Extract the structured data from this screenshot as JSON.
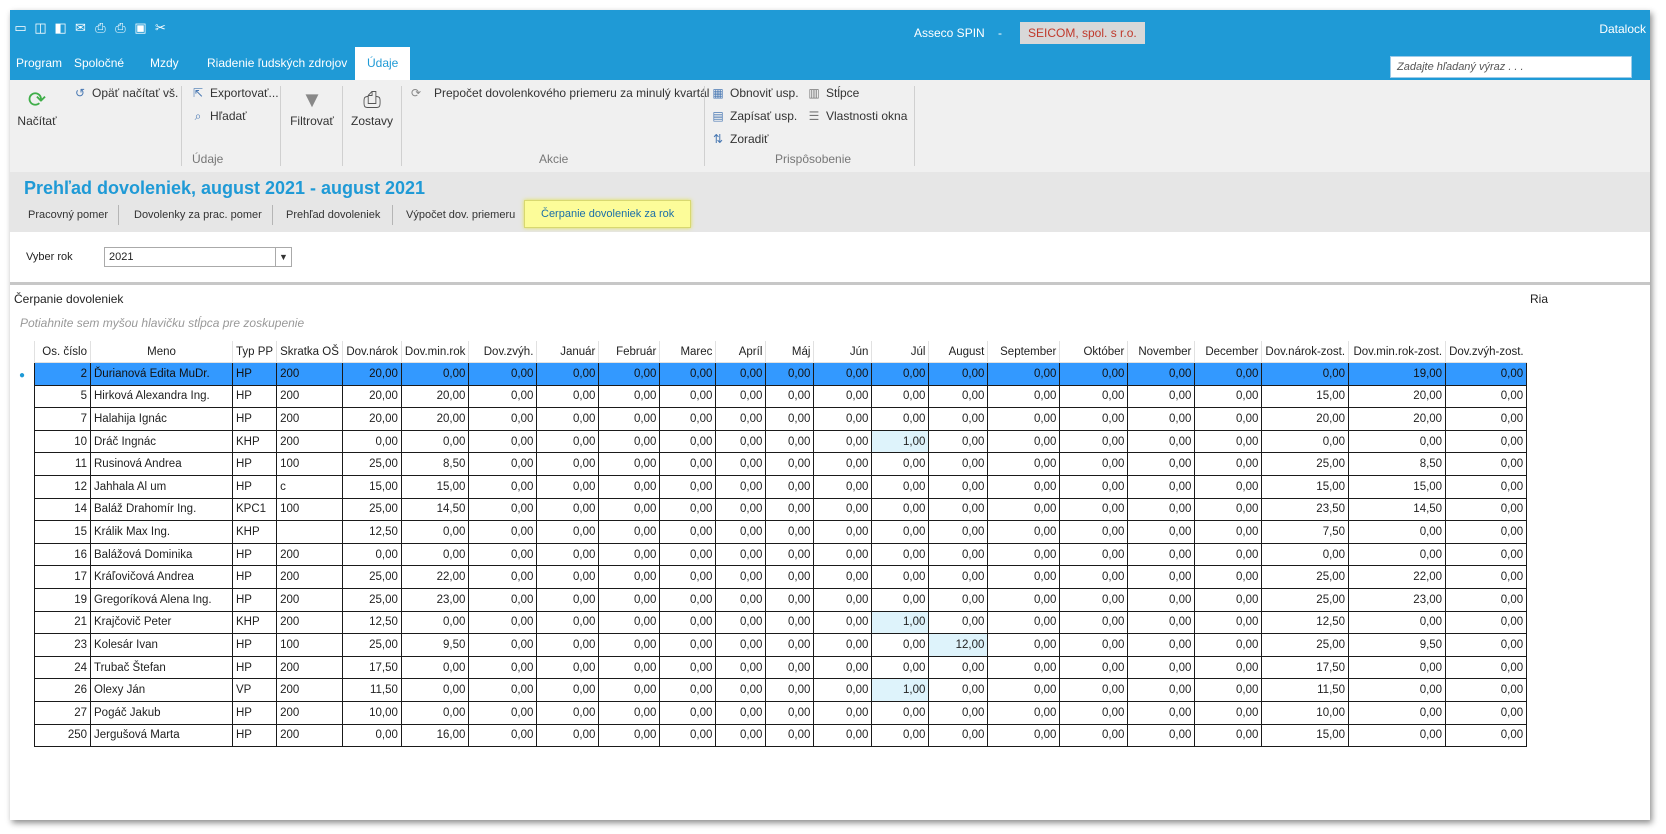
{
  "titlebar": {
    "qat_icons": [
      "minimize-icon",
      "dock-icon",
      "undock-icon",
      "mail-icon",
      "print-icon",
      "print-preview-icon",
      "export-icon",
      "tools-icon"
    ],
    "app_name": "Asseco SPIN",
    "separator": "-",
    "company": "SEICOM, spol. s r.o.",
    "right_label": "Datalock"
  },
  "menu": {
    "items": [
      "Program",
      "Spoločné",
      "Mzdy",
      "Riadenie ľudských zdrojov",
      "Údaje"
    ],
    "active": "Údaje",
    "search_placeholder": "Zadajte hľadaný výraz . . ."
  },
  "ribbon": {
    "nacitat": "Načítať",
    "opat": "Opäť načítať vš.",
    "exportovat": "Exportovať...",
    "hladat": "Hľadať",
    "filtrovat": "Filtrovať",
    "zostavy": "Zostavy",
    "prepocet": "Prepočet dovolenkového priemeru za minulý kvartál",
    "obnovit": "Obnoviť usp.",
    "zapisat": "Zapísať usp.",
    "zoradit": "Zoradiť",
    "stlpce": "Stĺpce",
    "vlastnosti": "Vlastnosti okna",
    "groups": {
      "udaje": "Údaje",
      "akcie": "Akcie",
      "prisposobenie": "Prispôsobenie"
    }
  },
  "page": {
    "title": "Prehľad dovoleniek, august 2021 - august 2021",
    "tabs": [
      "Pracovný pomer",
      "Dovolenky za prac. pomer",
      "Prehľad dovoleniek",
      "Výpočet dov. priemeru",
      "Čerpanie dovoleniek za rok"
    ],
    "active_tab": "Čerpanie dovoleniek za rok"
  },
  "filter": {
    "label": "Vyber rok",
    "value": "2021"
  },
  "grid": {
    "title": "Čerpanie dovoleniek",
    "right_label": "Ria",
    "group_hint": "Potiahnite sem myšou hlavičku stĺpca pre zoskupenie",
    "columns": [
      "Os. číslo",
      "Meno",
      "Typ PP",
      "Skratka OŠ",
      "Dov.nárok",
      "Dov.min.rok",
      "Dov.zvýh.",
      "Január",
      "Február",
      "Marec",
      "Apríl",
      "Máj",
      "Jún",
      "Júl",
      "August",
      "September",
      "Október",
      "November",
      "December",
      "Dov.nárok-zost.",
      "Dov.min.rok-zost.",
      "Dov.zvýh-zost."
    ],
    "rows": [
      [
        "2",
        "Ďurianová Edita MuDr.",
        "HP",
        "200",
        "20,00",
        "0,00",
        "0,00",
        "0,00",
        "0,00",
        "0,00",
        "0,00",
        "0,00",
        "0,00",
        "0,00",
        "0,00",
        "0,00",
        "0,00",
        "0,00",
        "0,00",
        "0,00",
        "19,00",
        "0,00"
      ],
      [
        "5",
        "Hirková Alexandra Ing.",
        "HP",
        "200",
        "20,00",
        "20,00",
        "0,00",
        "0,00",
        "0,00",
        "0,00",
        "0,00",
        "0,00",
        "0,00",
        "0,00",
        "0,00",
        "0,00",
        "0,00",
        "0,00",
        "0,00",
        "15,00",
        "20,00",
        "0,00"
      ],
      [
        "7",
        "Halahija Ignác",
        "HP",
        "200",
        "20,00",
        "20,00",
        "0,00",
        "0,00",
        "0,00",
        "0,00",
        "0,00",
        "0,00",
        "0,00",
        "0,00",
        "0,00",
        "0,00",
        "0,00",
        "0,00",
        "0,00",
        "20,00",
        "20,00",
        "0,00"
      ],
      [
        "10",
        "Dráč Ingnác",
        "KHP",
        "200",
        "0,00",
        "0,00",
        "0,00",
        "0,00",
        "0,00",
        "0,00",
        "0,00",
        "0,00",
        "0,00",
        "1,00",
        "0,00",
        "0,00",
        "0,00",
        "0,00",
        "0,00",
        "0,00",
        "0,00",
        "0,00"
      ],
      [
        "11",
        "Rusinová Andrea",
        "HP",
        "100",
        "25,00",
        "8,50",
        "0,00",
        "0,00",
        "0,00",
        "0,00",
        "0,00",
        "0,00",
        "0,00",
        "0,00",
        "0,00",
        "0,00",
        "0,00",
        "0,00",
        "0,00",
        "25,00",
        "8,50",
        "0,00"
      ],
      [
        "12",
        "Jahhala Al um",
        "HP",
        "c",
        "15,00",
        "15,00",
        "0,00",
        "0,00",
        "0,00",
        "0,00",
        "0,00",
        "0,00",
        "0,00",
        "0,00",
        "0,00",
        "0,00",
        "0,00",
        "0,00",
        "0,00",
        "15,00",
        "15,00",
        "0,00"
      ],
      [
        "14",
        "Baláž Drahomír Ing.",
        "KPC1",
        "100",
        "25,00",
        "14,50",
        "0,00",
        "0,00",
        "0,00",
        "0,00",
        "0,00",
        "0,00",
        "0,00",
        "0,00",
        "0,00",
        "0,00",
        "0,00",
        "0,00",
        "0,00",
        "23,50",
        "14,50",
        "0,00"
      ],
      [
        "15",
        "Králik Max Ing.",
        "KHP",
        "",
        "12,50",
        "0,00",
        "0,00",
        "0,00",
        "0,00",
        "0,00",
        "0,00",
        "0,00",
        "0,00",
        "0,00",
        "0,00",
        "0,00",
        "0,00",
        "0,00",
        "0,00",
        "7,50",
        "0,00",
        "0,00"
      ],
      [
        "16",
        "Balážová Dominika",
        "HP",
        "200",
        "0,00",
        "0,00",
        "0,00",
        "0,00",
        "0,00",
        "0,00",
        "0,00",
        "0,00",
        "0,00",
        "0,00",
        "0,00",
        "0,00",
        "0,00",
        "0,00",
        "0,00",
        "0,00",
        "0,00",
        "0,00"
      ],
      [
        "17",
        "Kráľovičová Andrea",
        "HP",
        "200",
        "25,00",
        "22,00",
        "0,00",
        "0,00",
        "0,00",
        "0,00",
        "0,00",
        "0,00",
        "0,00",
        "0,00",
        "0,00",
        "0,00",
        "0,00",
        "0,00",
        "0,00",
        "25,00",
        "22,00",
        "0,00"
      ],
      [
        "19",
        "Gregoríková Alena Ing.",
        "HP",
        "200",
        "25,00",
        "23,00",
        "0,00",
        "0,00",
        "0,00",
        "0,00",
        "0,00",
        "0,00",
        "0,00",
        "0,00",
        "0,00",
        "0,00",
        "0,00",
        "0,00",
        "0,00",
        "25,00",
        "23,00",
        "0,00"
      ],
      [
        "21",
        "Krajčovič Peter",
        "KHP",
        "200",
        "12,50",
        "0,00",
        "0,00",
        "0,00",
        "0,00",
        "0,00",
        "0,00",
        "0,00",
        "0,00",
        "1,00",
        "0,00",
        "0,00",
        "0,00",
        "0,00",
        "0,00",
        "12,50",
        "0,00",
        "0,00"
      ],
      [
        "23",
        "Kolesár Ivan",
        "HP",
        "100",
        "25,00",
        "9,50",
        "0,00",
        "0,00",
        "0,00",
        "0,00",
        "0,00",
        "0,00",
        "0,00",
        "0,00",
        "12,00",
        "0,00",
        "0,00",
        "0,00",
        "0,00",
        "25,00",
        "9,50",
        "0,00"
      ],
      [
        "24",
        "Trubač Štefan",
        "HP",
        "200",
        "17,50",
        "0,00",
        "0,00",
        "0,00",
        "0,00",
        "0,00",
        "0,00",
        "0,00",
        "0,00",
        "0,00",
        "0,00",
        "0,00",
        "0,00",
        "0,00",
        "0,00",
        "17,50",
        "0,00",
        "0,00"
      ],
      [
        "26",
        "Olexy Ján",
        "VP",
        "200",
        "11,50",
        "0,00",
        "0,00",
        "0,00",
        "0,00",
        "0,00",
        "0,00",
        "0,00",
        "0,00",
        "1,00",
        "0,00",
        "0,00",
        "0,00",
        "0,00",
        "0,00",
        "11,50",
        "0,00",
        "0,00"
      ],
      [
        "27",
        "Pogáč Jakub",
        "HP",
        "200",
        "10,00",
        "0,00",
        "0,00",
        "0,00",
        "0,00",
        "0,00",
        "0,00",
        "0,00",
        "0,00",
        "0,00",
        "0,00",
        "0,00",
        "0,00",
        "0,00",
        "0,00",
        "10,00",
        "0,00",
        "0,00"
      ],
      [
        "250",
        "Jergušová Marta",
        "HP",
        "200",
        "0,00",
        "16,00",
        "0,00",
        "0,00",
        "0,00",
        "0,00",
        "0,00",
        "0,00",
        "0,00",
        "0,00",
        "0,00",
        "0,00",
        "0,00",
        "0,00",
        "0,00",
        "15,00",
        "0,00",
        "0,00"
      ]
    ],
    "highlighted": [
      [
        3,
        13
      ],
      [
        11,
        13
      ],
      [
        12,
        14
      ],
      [
        14,
        13
      ]
    ],
    "selected_row": 0
  }
}
